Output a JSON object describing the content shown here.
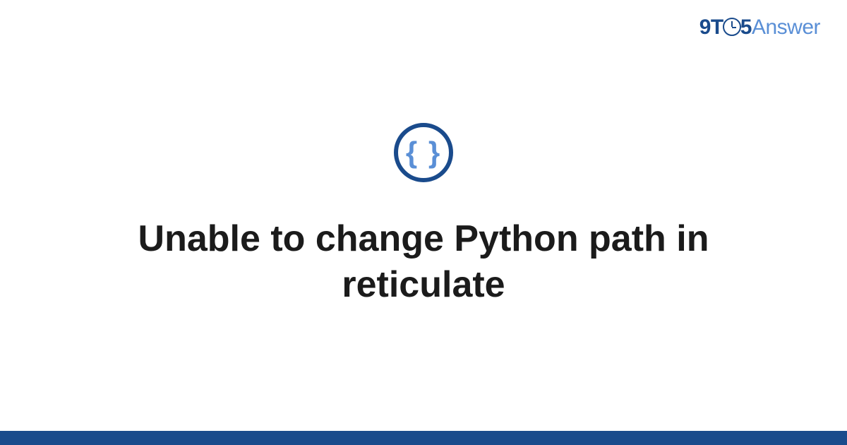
{
  "logo": {
    "part1": "9T",
    "part2": "5",
    "part3": "Answer"
  },
  "icon": {
    "braces": "{ }"
  },
  "title": "Unable to change Python path in reticulate",
  "colors": {
    "primary": "#1a4b8c",
    "accent": "#5a8fd6"
  }
}
